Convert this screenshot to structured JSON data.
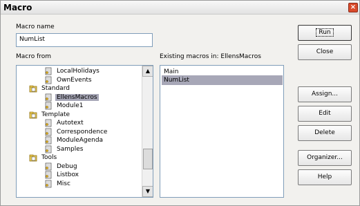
{
  "window": {
    "title": "Macro",
    "close_glyph": "×"
  },
  "macro_name": {
    "label": "Macro name",
    "value": "NumList"
  },
  "macro_from": {
    "label": "Macro from"
  },
  "existing": {
    "label": "Existing macros in: EllensMacros",
    "items": [
      "Main",
      "NumList"
    ],
    "selected": "NumList"
  },
  "tree": {
    "items": [
      {
        "label": "LocalHolidays",
        "level": 2,
        "icon": "module-icon"
      },
      {
        "label": "OwnEvents",
        "level": 2,
        "icon": "module-icon"
      },
      {
        "label": "Standard",
        "level": 1,
        "icon": "library-icon"
      },
      {
        "label": "EllensMacros",
        "level": 2,
        "icon": "module-icon",
        "selected": true
      },
      {
        "label": "Module1",
        "level": 2,
        "icon": "module-icon"
      },
      {
        "label": "Template",
        "level": 1,
        "icon": "library-icon"
      },
      {
        "label": "Autotext",
        "level": 2,
        "icon": "module-icon"
      },
      {
        "label": "Correspondence",
        "level": 2,
        "icon": "module-icon"
      },
      {
        "label": "ModuleAgenda",
        "level": 2,
        "icon": "module-icon"
      },
      {
        "label": "Samples",
        "level": 2,
        "icon": "module-icon"
      },
      {
        "label": "Tools",
        "level": 1,
        "icon": "library-icon"
      },
      {
        "label": "Debug",
        "level": 2,
        "icon": "module-icon"
      },
      {
        "label": "Listbox",
        "level": 2,
        "icon": "module-icon"
      },
      {
        "label": "Misc",
        "level": 2,
        "icon": "module-icon"
      }
    ]
  },
  "buttons": {
    "run": "Run",
    "close": "Close",
    "assign": "Assign...",
    "edit": "Edit",
    "delete": "Delete",
    "organizer": "Organizer...",
    "help": "Help"
  }
}
